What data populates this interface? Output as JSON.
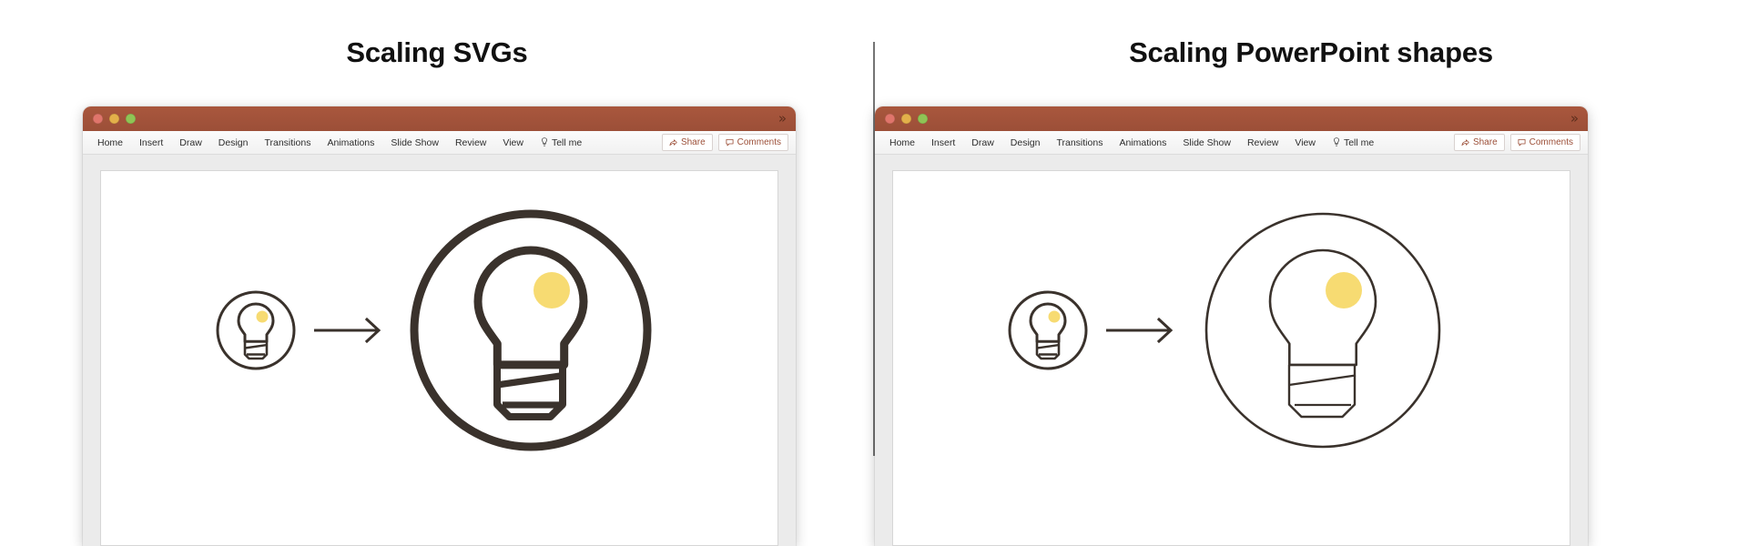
{
  "page": {
    "background": "#ffffff",
    "divider_color": "#747474"
  },
  "panels": [
    {
      "id": "svg-panel",
      "title": "Scaling SVGs",
      "window": {
        "titlebar": {
          "color": "#a2523a",
          "traffic_lights": [
            {
              "name": "close",
              "color": "#e0756b"
            },
            {
              "name": "minimize",
              "color": "#e3b04a"
            },
            {
              "name": "maximize",
              "color": "#8fc455"
            }
          ],
          "more_icon": "»"
        },
        "ribbon": {
          "tabs": [
            "Home",
            "Insert",
            "Draw",
            "Design",
            "Transitions",
            "Animations",
            "Slide Show",
            "Review",
            "View"
          ],
          "tell_me": "Tell me",
          "tell_me_icon": "lightbulb-icon",
          "share_label": "Share",
          "share_icon": "share-icon",
          "comments_label": "Comments",
          "comments_icon": "comment-icon",
          "accent_color": "#9c4f38"
        },
        "slide": {
          "background": "#ffffff",
          "stroke_color": "#3a322c",
          "highlight_color": "#f7db72",
          "stroke_scales": true,
          "small_icon": {
            "name": "lightbulb-in-circle-small",
            "circle_radius": 42,
            "stroke_width": 3
          },
          "arrow": {
            "name": "arrow-right",
            "stroke_width": 3
          },
          "large_icon": {
            "name": "lightbulb-in-circle-large",
            "circle_radius": 128,
            "stroke_width": 9
          }
        }
      }
    },
    {
      "id": "powerpoint-panel",
      "title": "Scaling PowerPoint shapes",
      "window": {
        "titlebar": {
          "color": "#a2523a",
          "traffic_lights": [
            {
              "name": "close",
              "color": "#e0756b"
            },
            {
              "name": "minimize",
              "color": "#e3b04a"
            },
            {
              "name": "maximize",
              "color": "#8fc455"
            }
          ],
          "more_icon": "»"
        },
        "ribbon": {
          "tabs": [
            "Home",
            "Insert",
            "Draw",
            "Design",
            "Transitions",
            "Animations",
            "Slide Show",
            "Review",
            "View"
          ],
          "tell_me": "Tell me",
          "tell_me_icon": "lightbulb-icon",
          "share_label": "Share",
          "share_icon": "share-icon",
          "comments_label": "Comments",
          "comments_icon": "comment-icon",
          "accent_color": "#9c4f38"
        },
        "slide": {
          "background": "#ffffff",
          "stroke_color": "#3a322c",
          "highlight_color": "#f7db72",
          "stroke_scales": false,
          "small_icon": {
            "name": "lightbulb-in-circle-small",
            "circle_radius": 42,
            "stroke_width": 3
          },
          "arrow": {
            "name": "arrow-right",
            "stroke_width": 3
          },
          "large_icon": {
            "name": "lightbulb-in-circle-large",
            "circle_radius": 128,
            "stroke_width": 3
          }
        }
      }
    }
  ]
}
